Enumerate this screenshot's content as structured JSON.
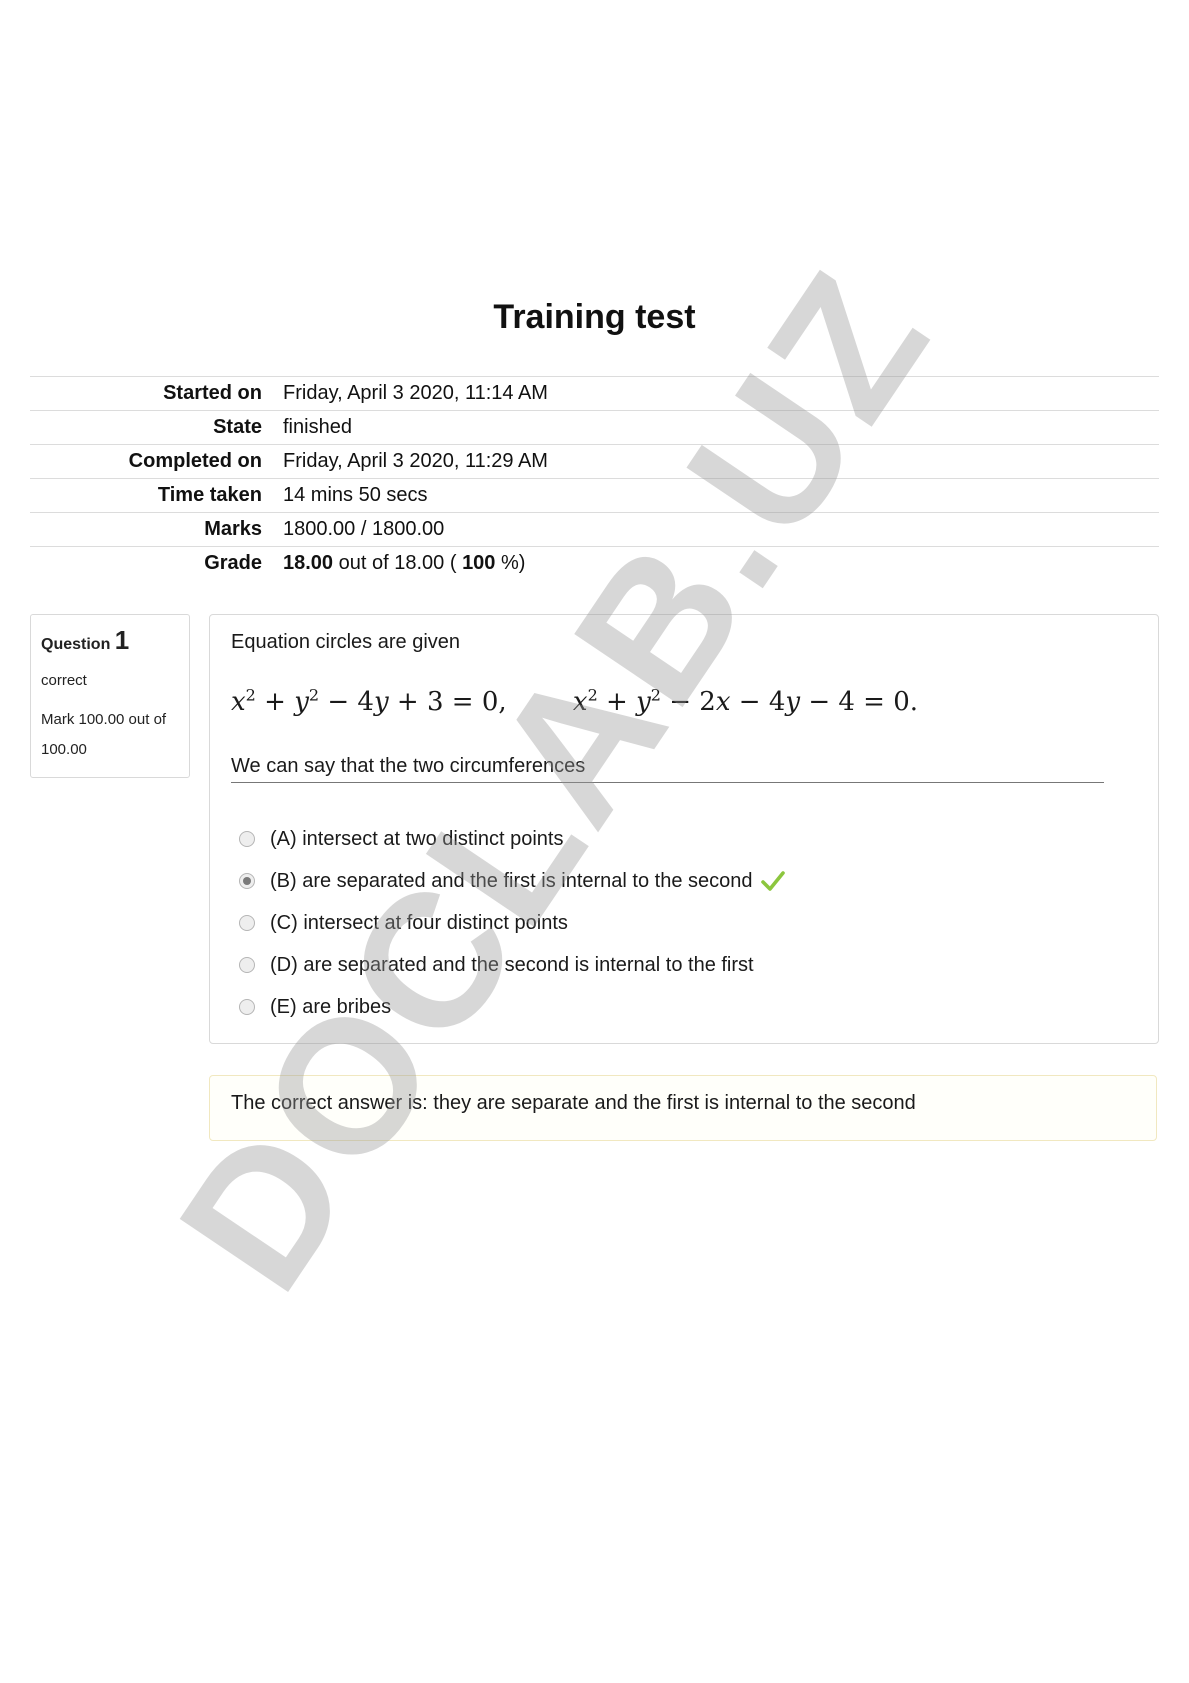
{
  "page": {
    "title": "Training test"
  },
  "summary": {
    "rows": [
      {
        "label": "Started on",
        "value": "Friday, April 3 2020, 11:14 AM"
      },
      {
        "label": "State",
        "value": "finished"
      },
      {
        "label": "Completed on",
        "value": "Friday, April 3 2020, 11:29 AM"
      },
      {
        "label": "Time taken",
        "value": "14 mins 50 secs"
      },
      {
        "label": "Marks",
        "value": "1800.00 / 1800.00"
      }
    ],
    "grade": {
      "label": "Grade",
      "score": "18.00",
      "out_of_text": "out of 18.00 (",
      "percent": "100",
      "percent_suffix": "%)"
    }
  },
  "question": {
    "label": "Question",
    "number": "1",
    "state": "correct",
    "mark": "Mark 100.00 out of 100.00",
    "text": "Equation circles are given",
    "subtext": "We can say that the two circumferences",
    "formula": {
      "eq1": {
        "x": "x",
        "exp": "2",
        "plus1": "+",
        "y": "y",
        "exp2": "2",
        "rest": "− 4",
        "y2": "y",
        "tail": "+ 3 = 0,"
      },
      "eq2": {
        "x": "x",
        "exp": "2",
        "plus1": "+",
        "y": "y",
        "exp2": "2",
        "rest": "− 2",
        "x2": "x",
        "mid": "− 4",
        "y2": "y",
        "tail": "− 4 = 0."
      }
    },
    "answers": [
      {
        "text": "(A) intersect at two distinct points",
        "selected": false,
        "correct": false
      },
      {
        "text": "(B) are separated and the first is internal to the second",
        "selected": true,
        "correct": true
      },
      {
        "text": "(C) intersect at four distinct points",
        "selected": false,
        "correct": false
      },
      {
        "text": "(D) are separated and the second is internal to the first",
        "selected": false,
        "correct": false
      },
      {
        "text": "(E) are bribes",
        "selected": false,
        "correct": false
      }
    ],
    "feedback": "The correct answer is: they are separate and the first is internal to the second"
  },
  "watermark": {
    "text": "DOCLAB.UZ"
  },
  "colors": {
    "check": "#8cc63e",
    "border": "#d9d9d9",
    "feedback_border": "#f1e8c0"
  },
  "icons": {
    "correct": "check-icon"
  }
}
